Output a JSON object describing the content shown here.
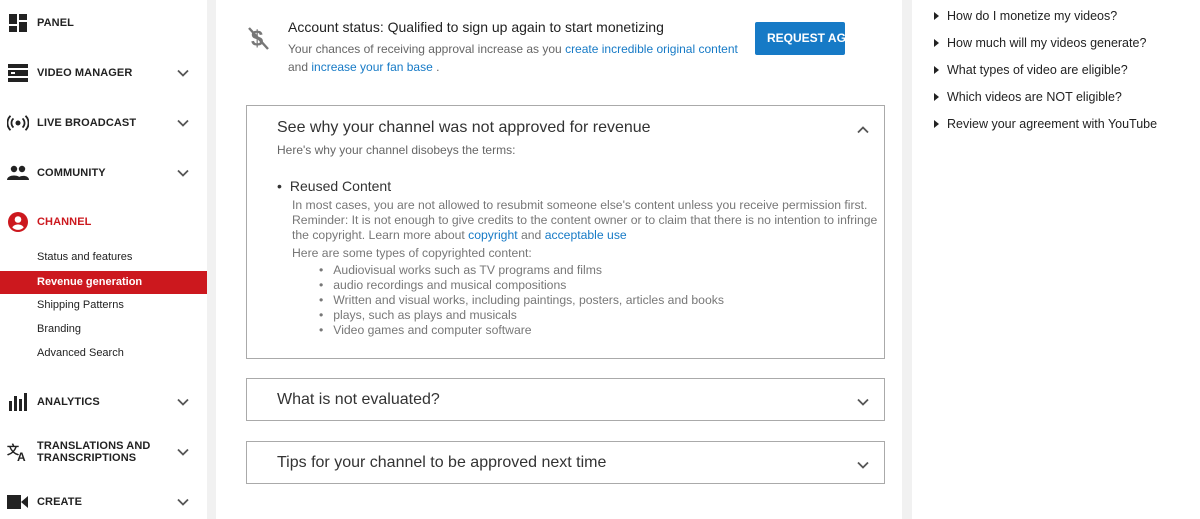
{
  "sidebar": {
    "items": [
      {
        "label": "PANEL",
        "icon": "dashboard-icon"
      },
      {
        "label": "VIDEO MANAGER",
        "icon": "video-manager-icon"
      },
      {
        "label": "LIVE BROADCAST",
        "icon": "live-broadcast-icon"
      },
      {
        "label": "COMMUNITY",
        "icon": "community-icon"
      },
      {
        "label": "CHANNEL",
        "icon": "channel-icon"
      },
      {
        "label": "ANALYTICS",
        "icon": "analytics-icon"
      },
      {
        "label": "TRANSLATIONS AND\nTRANSCRIPTIONS",
        "icon": "translate-icon"
      },
      {
        "label": "CREATE",
        "icon": "create-icon"
      }
    ],
    "channel_sub": [
      {
        "label": "Status and features"
      },
      {
        "label": "Revenue generation"
      },
      {
        "label": "Shipping Patterns"
      },
      {
        "label": "Branding"
      },
      {
        "label": "Advanced Search"
      }
    ],
    "accent": "#cc181e"
  },
  "status": {
    "title": "Account status: Qualified to sign up again to start monetizing",
    "desc_prefix": "Your chances of receiving approval increase as you ",
    "link1": "create incredible original content",
    "desc_mid": " and ",
    "link2": "increase your fan base",
    "desc_suffix": " .",
    "button": "REQUEST AGAIN",
    "button_color": "#167ac6"
  },
  "panels": {
    "why": {
      "title": "See why your channel was not approved for revenue",
      "subtitle": "Here's why your channel disobeys the terms:",
      "reason_title": "Reused Content",
      "reason_text_prefix": "In most cases, you are not allowed to resubmit someone else's content unless you receive permission first. Reminder: It is not enough to give credits to the content owner or to claim that there is no intention to infringe the copyright. Learn more about ",
      "link_copyright": "copyright",
      "reason_and": " and ",
      "link_acceptable": "acceptable use",
      "types_head": "Here are some types of copyrighted content:",
      "types": [
        "Audiovisual works such as TV programs and films",
        "audio recordings and musical compositions",
        "Written and visual works, including paintings, posters, articles and books",
        "plays, such as plays and musicals",
        "Video games and computer software"
      ]
    },
    "not_evaluated": {
      "title": "What is not evaluated?"
    },
    "tips": {
      "title": "Tips for your channel to be approved next time"
    }
  },
  "faq": [
    "How do I monetize my videos?",
    "How much will my videos generate?",
    "What types of video are eligible?",
    "Which videos are NOT eligible?",
    "Review your agreement with YouTube"
  ]
}
